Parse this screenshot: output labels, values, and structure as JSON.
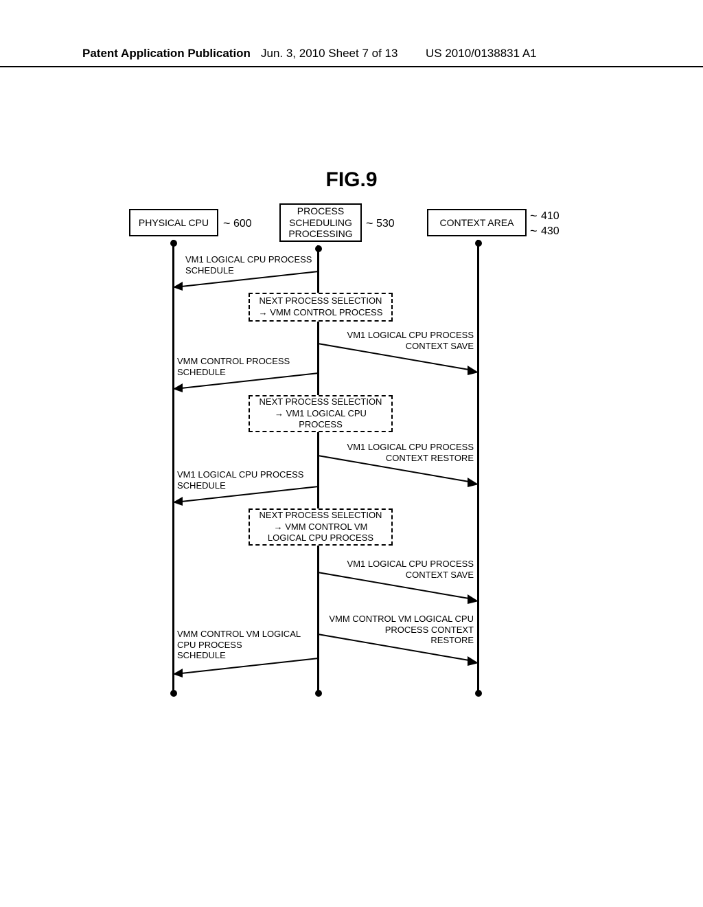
{
  "header": {
    "left": "Patent Application Publication",
    "center": "Jun. 3, 2010  Sheet 7 of 13",
    "right": "US 2010/0138831 A1"
  },
  "figure_title": "FIG.9",
  "boxes": {
    "physical_cpu": "PHYSICAL CPU",
    "process_scheduling": "PROCESS\nSCHEDULING\nPROCESSING",
    "context_area": "CONTEXT AREA"
  },
  "box_labels": {
    "physical_cpu": "600",
    "process_scheduling": "530",
    "context_area_top": "410",
    "context_area_bottom": "430"
  },
  "messages": {
    "vm1_schedule_1": "VM1 LOGICAL CPU PROCESS\nSCHEDULE",
    "next_select_1": "NEXT PROCESS SELECTION\n→ VMM CONTROL PROCESS",
    "context_save_1": "VM1 LOGICAL CPU PROCESS\nCONTEXT SAVE",
    "vmm_control_schedule": "VMM CONTROL PROCESS\nSCHEDULE",
    "next_select_2": "NEXT PROCESS SELECTION\n→ VM1 LOGICAL CPU\nPROCESS",
    "context_restore_1": "VM1 LOGICAL CPU PROCESS\nCONTEXT RESTORE",
    "vm1_schedule_2": "VM1 LOGICAL CPU PROCESS\nSCHEDULE",
    "next_select_3": "NEXT PROCESS SELECTION\n→ VMM CONTROL VM\nLOGICAL CPU PROCESS",
    "context_save_2": "VM1 LOGICAL CPU PROCESS\nCONTEXT SAVE",
    "vmm_context_restore": "VMM CONTROL VM LOGICAL CPU\nPROCESS CONTEXT\nRESTORE",
    "vmm_control_vm_schedule": "VMM CONTROL VM LOGICAL\nCPU PROCESS\nSCHEDULE"
  }
}
